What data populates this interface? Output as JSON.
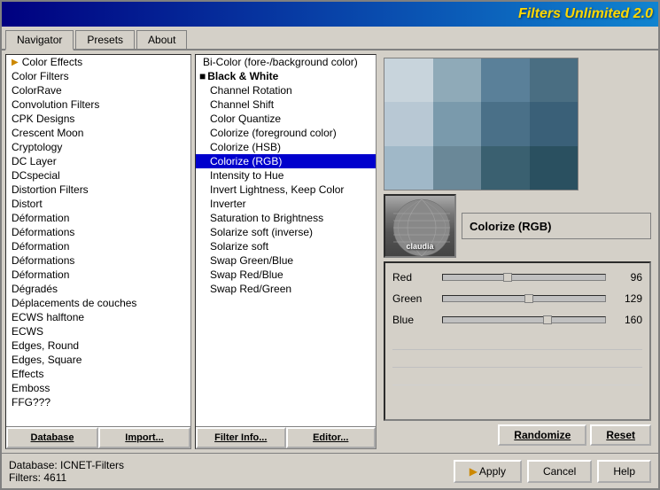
{
  "title": "Filters Unlimited 2.0",
  "tabs": [
    {
      "id": "navigator",
      "label": "Navigator",
      "active": true
    },
    {
      "id": "presets",
      "label": "Presets",
      "active": false
    },
    {
      "id": "about",
      "label": "About",
      "active": false
    }
  ],
  "left_panel": {
    "items": [
      {
        "label": "Color Effects",
        "selected": false,
        "hasArrow": true
      },
      {
        "label": "Color Filters",
        "selected": false,
        "hasArrow": false
      },
      {
        "label": "ColorRave",
        "selected": false,
        "hasArrow": false
      },
      {
        "label": "Convolution Filters",
        "selected": false,
        "hasArrow": false
      },
      {
        "label": "CPK Designs",
        "selected": false,
        "hasArrow": false
      },
      {
        "label": "Crescent Moon",
        "selected": false,
        "hasArrow": false
      },
      {
        "label": "Cryptology",
        "selected": false,
        "hasArrow": false
      },
      {
        "label": "DC Layer",
        "selected": false,
        "hasArrow": false
      },
      {
        "label": "DCspecial",
        "selected": false,
        "hasArrow": false
      },
      {
        "label": "Distortion Filters",
        "selected": false,
        "hasArrow": false
      },
      {
        "label": "Distort",
        "selected": false,
        "hasArrow": false
      },
      {
        "label": "Déformation",
        "selected": false,
        "hasArrow": false
      },
      {
        "label": "Déformations",
        "selected": false,
        "hasArrow": false
      },
      {
        "label": "Déformation",
        "selected": false,
        "hasArrow": false
      },
      {
        "label": "Déformations",
        "selected": false,
        "hasArrow": false
      },
      {
        "label": "Déformation",
        "selected": false,
        "hasArrow": false
      },
      {
        "label": "Dégradés",
        "selected": false,
        "hasArrow": false
      },
      {
        "label": "Déplacements de couches",
        "selected": false,
        "hasArrow": false
      },
      {
        "label": "ECWS halftone",
        "selected": false,
        "hasArrow": false
      },
      {
        "label": "ECWS",
        "selected": false,
        "hasArrow": false
      },
      {
        "label": "Edges, Round",
        "selected": false,
        "hasArrow": false
      },
      {
        "label": "Edges, Square",
        "selected": false,
        "hasArrow": false
      },
      {
        "label": "Effects",
        "selected": false,
        "hasArrow": false
      },
      {
        "label": "Emboss",
        "selected": false,
        "hasArrow": false
      },
      {
        "label": "FFG???",
        "selected": false,
        "hasArrow": false
      }
    ]
  },
  "middle_panel": {
    "items": [
      {
        "label": "Bi-Color (fore-/background color)",
        "selected": false,
        "isCategory": false
      },
      {
        "label": "Black & White",
        "selected": false,
        "isCategory": true
      },
      {
        "label": "Channel Rotation",
        "selected": false,
        "isCategory": false,
        "isSub": true
      },
      {
        "label": "Channel Shift",
        "selected": false,
        "isCategory": false,
        "isSub": true
      },
      {
        "label": "Color Quantize",
        "selected": false,
        "isCategory": false,
        "isSub": true
      },
      {
        "label": "Colorize (foreground color)",
        "selected": false,
        "isCategory": false,
        "isSub": true
      },
      {
        "label": "Colorize (HSB)",
        "selected": false,
        "isCategory": false,
        "isSub": true
      },
      {
        "label": "Colorize (RGB)",
        "selected": true,
        "isCategory": false,
        "isSub": true
      },
      {
        "label": "Intensity to Hue",
        "selected": false,
        "isCategory": false,
        "isSub": true
      },
      {
        "label": "Invert Lightness, Keep Color",
        "selected": false,
        "isCategory": false,
        "isSub": true
      },
      {
        "label": "Inverter",
        "selected": false,
        "isCategory": false,
        "isSub": true
      },
      {
        "label": "Saturation to Brightness",
        "selected": false,
        "isCategory": false,
        "isSub": true
      },
      {
        "label": "Solarize soft (inverse)",
        "selected": false,
        "isCategory": false,
        "isSub": true
      },
      {
        "label": "Solarize soft",
        "selected": false,
        "isCategory": false,
        "isSub": true
      },
      {
        "label": "Swap Green/Blue",
        "selected": false,
        "isCategory": false,
        "isSub": true
      },
      {
        "label": "Swap Red/Blue",
        "selected": false,
        "isCategory": false,
        "isSub": true
      },
      {
        "label": "Swap Red/Green",
        "selected": false,
        "isCategory": false,
        "isSub": true
      }
    ]
  },
  "right_panel": {
    "filter_name": "Colorize (RGB)",
    "sliders": [
      {
        "label": "Red",
        "value": 96,
        "percent": 37
      },
      {
        "label": "Green",
        "value": 129,
        "percent": 50
      },
      {
        "label": "Blue",
        "value": 160,
        "percent": 62
      }
    ],
    "swatches": [
      "#c8d4dc",
      "#8faab8",
      "#5a8099",
      "#4a6e82",
      "#b8c8d4",
      "#7a9aac",
      "#4a7088",
      "#3a6078",
      "#a0b8c8",
      "#6a8898",
      "#3a6070",
      "#2a5060"
    ],
    "buttons": [
      {
        "id": "randomize",
        "label": "Randomize"
      },
      {
        "id": "reset",
        "label": "Reset"
      }
    ]
  },
  "bottom_buttons": [
    {
      "id": "database",
      "label": "Database"
    },
    {
      "id": "import",
      "label": "Import..."
    },
    {
      "id": "filter-info",
      "label": "Filter Info..."
    },
    {
      "id": "editor",
      "label": "Editor..."
    }
  ],
  "status": {
    "database_label": "Database:",
    "database_value": "ICNET-Filters",
    "filters_label": "Filters:",
    "filters_value": "4611"
  },
  "action_buttons": [
    {
      "id": "apply",
      "label": "Apply"
    },
    {
      "id": "cancel",
      "label": "Cancel"
    },
    {
      "id": "help",
      "label": "Help"
    }
  ]
}
